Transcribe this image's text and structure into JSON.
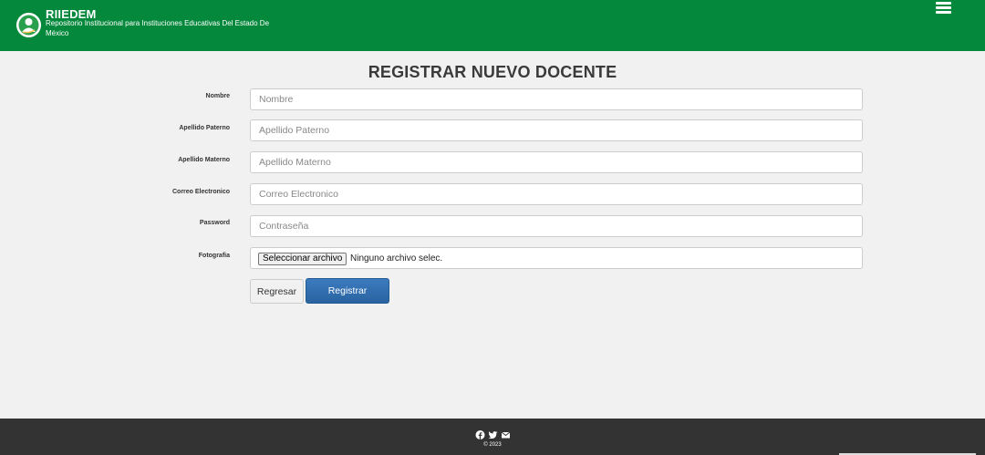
{
  "header": {
    "title": "RIIEDEM",
    "subtitle": "Repositorio Institucional para Instituciones Educativas Del Estado De México",
    "brand_color": "#04883b",
    "logo_icon": "user-circle-logo",
    "menu_icon": "hamburger-menu-icon"
  },
  "page": {
    "title": "REGISTRAR NUEVO DOCENTE"
  },
  "form": {
    "nombre": {
      "label": "Nombre",
      "placeholder": "Nombre",
      "value": ""
    },
    "apellido_paterno": {
      "label": "Apellido Paterno",
      "placeholder": "Apellido Paterno",
      "value": ""
    },
    "apellido_materno": {
      "label": "Apellido Materno",
      "placeholder": "Apellido Materno",
      "value": ""
    },
    "correo": {
      "label": "Correo Electronico",
      "placeholder": "Correo Electronico",
      "value": ""
    },
    "password": {
      "label": "Password",
      "placeholder": "Contraseña",
      "value": ""
    },
    "fotografia": {
      "label": "Fotografia",
      "button_label": "Seleccionar archivo",
      "status": "Ninguno archivo selec."
    }
  },
  "buttons": {
    "back_label": "Regresar",
    "submit_label": "Registrar",
    "submit_color": "#2f6db0"
  },
  "footer": {
    "icons": [
      "facebook-icon",
      "twitter-icon",
      "mail-icon"
    ],
    "copyright": "© 2023",
    "background": "#333333"
  }
}
